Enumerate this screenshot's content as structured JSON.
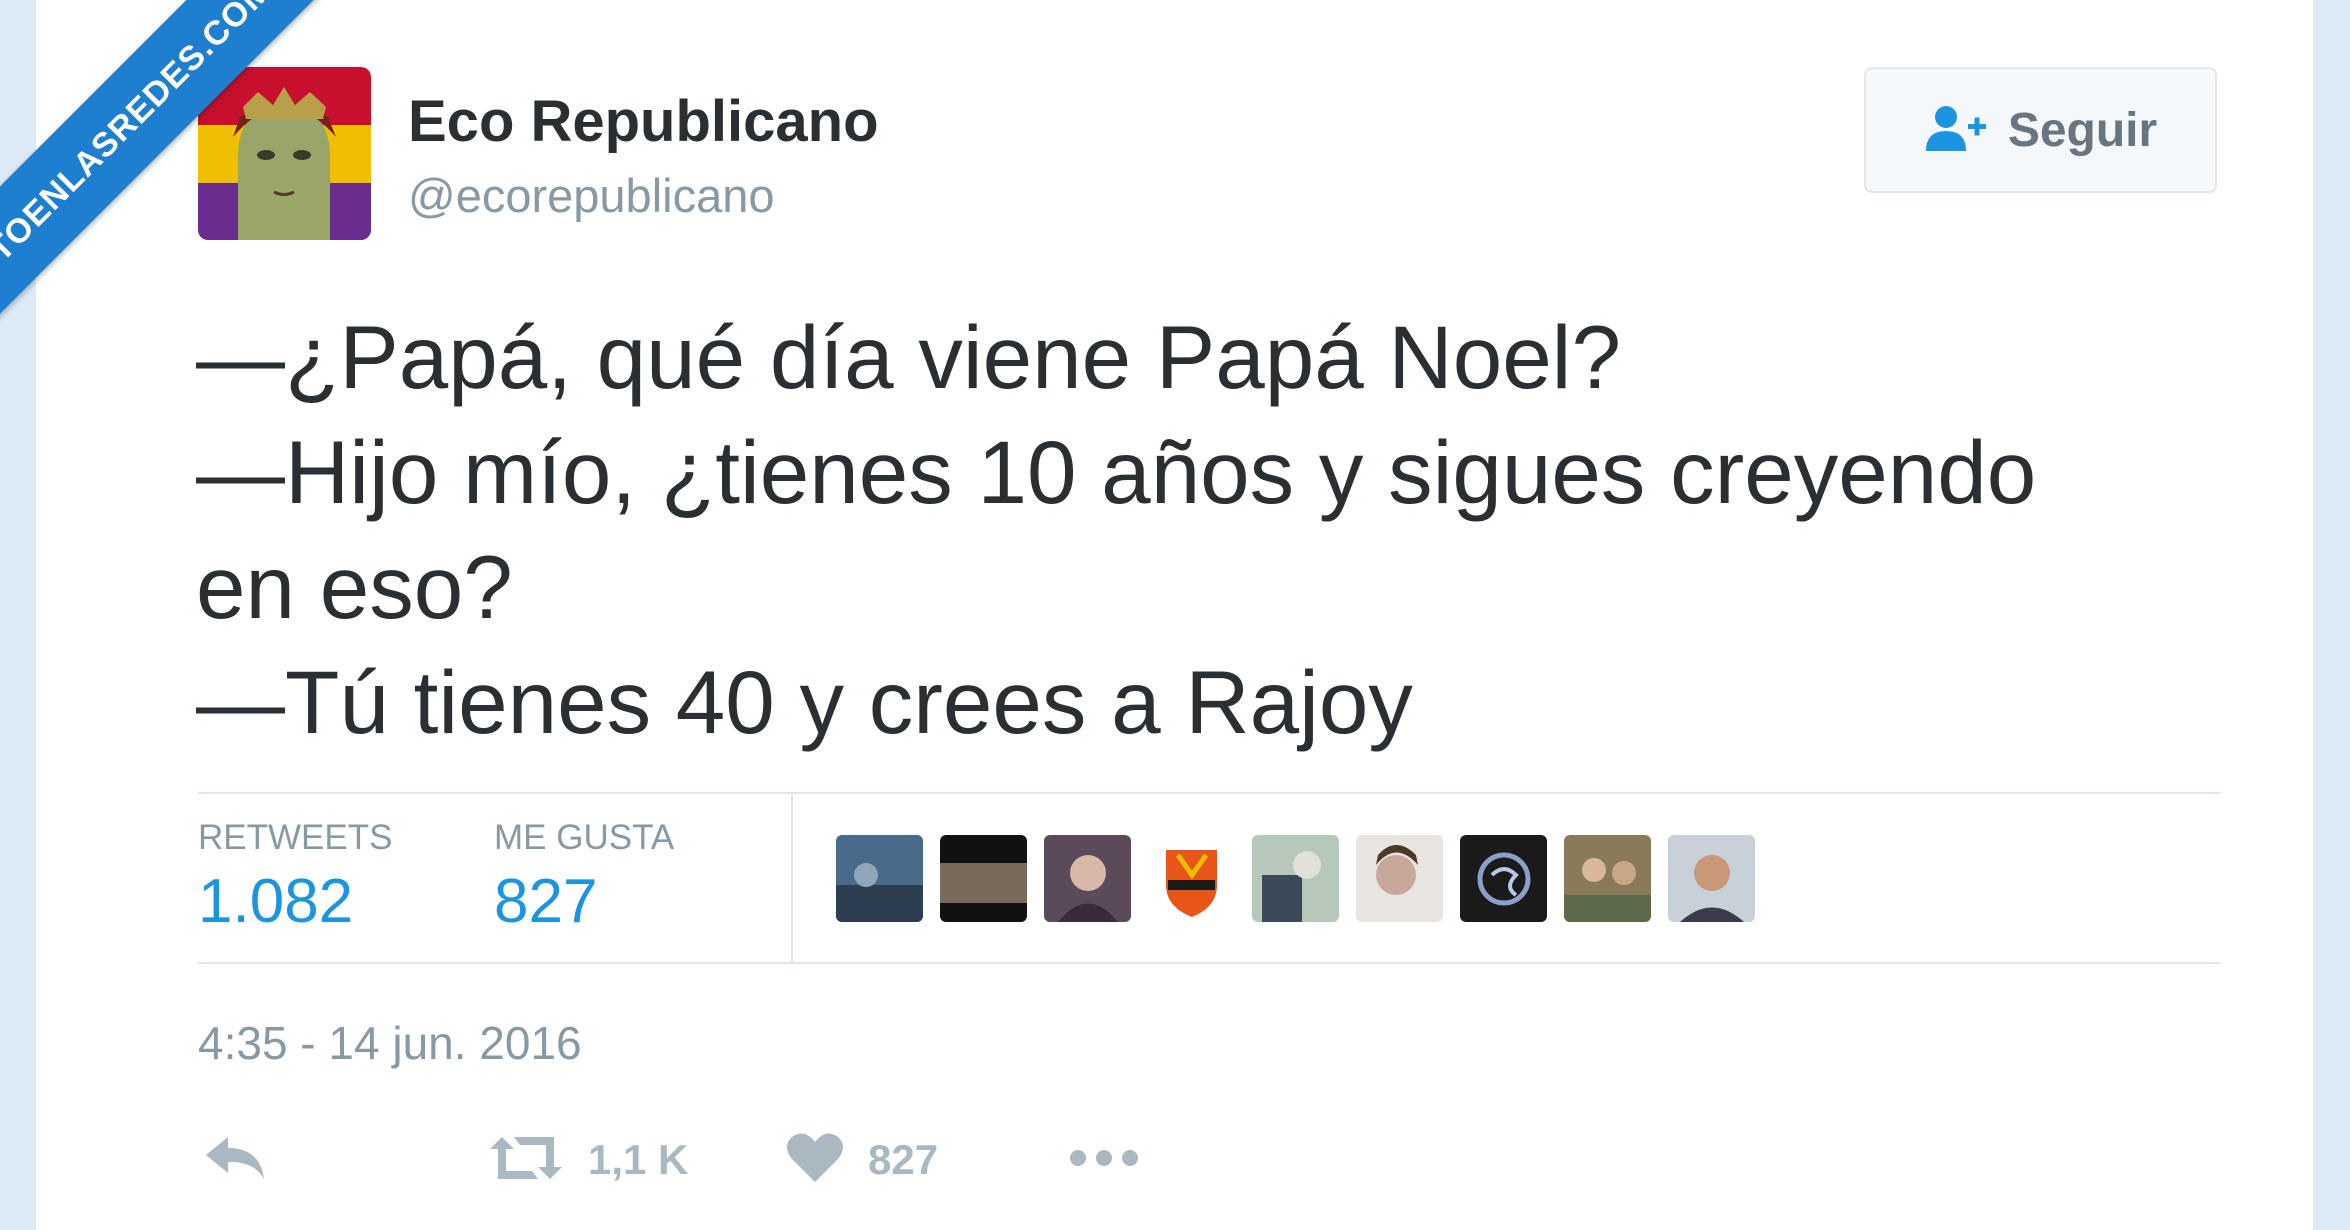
{
  "watermark": {
    "text": "VISTOENLASREDES.COM"
  },
  "author": {
    "name": "Eco Republicano",
    "handle": "@ecorepublicano",
    "avatar_icon": "avatar-illustration"
  },
  "follow_button": {
    "label": "Seguir",
    "icon": "add-user-icon"
  },
  "tweet": {
    "lines": [
      "—¿Papá, qué día viene Papá Noel?",
      "—Hijo mío, ¿tienes 10 años y sigues creyendo",
      "en eso?",
      "—Tú tienes 40 y crees a Rajoy"
    ]
  },
  "stats": {
    "retweets_label": "RETWEETS",
    "retweets_value": "1.082",
    "likes_label": "ME GUSTA",
    "likes_value": "827"
  },
  "timestamp": "4:35 - 14 jun. 2016",
  "actions": {
    "reply_icon": "reply-icon",
    "retweet_icon": "retweet-icon",
    "retweet_count": "1,1 K",
    "like_icon": "heart-icon",
    "like_count": "827",
    "more_icon": "more-icon"
  },
  "colors": {
    "accent": "#1b95e0",
    "muted": "#8899a6",
    "text": "#292f33",
    "action_gray": "#aab8c2",
    "watermark_bg": "#1e7fd0"
  }
}
